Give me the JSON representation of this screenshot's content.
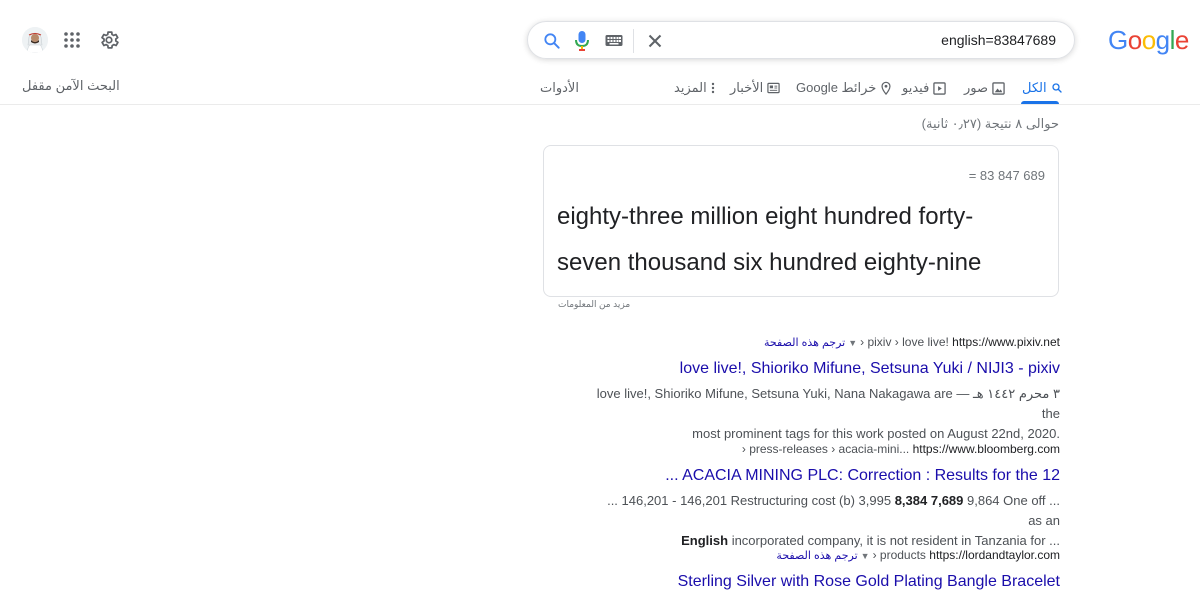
{
  "header": {
    "logo_letters": [
      {
        "char": "G",
        "color": "#4285f4"
      },
      {
        "char": "o",
        "color": "#ea4335"
      },
      {
        "char": "o",
        "color": "#fbbc05"
      },
      {
        "char": "g",
        "color": "#4285f4"
      },
      {
        "char": "l",
        "color": "#34a853"
      },
      {
        "char": "e",
        "color": "#ea4335"
      }
    ],
    "search_query": "english=83847689",
    "icons": [
      "search-icon",
      "mic-icon",
      "keyboard-icon",
      "clear-icon",
      "settings-icon",
      "apps-icon"
    ]
  },
  "nav": {
    "tabs": [
      {
        "label": "الكل",
        "icon": "search-icon",
        "active": true
      },
      {
        "label": "صور",
        "icon": "image-icon",
        "active": false
      },
      {
        "label": "فيديو",
        "icon": "video-icon",
        "active": false
      },
      {
        "label": "خرائط Google",
        "icon": "map-pin-icon",
        "active": false
      },
      {
        "label": "الأخبار",
        "icon": "news-icon",
        "active": false
      },
      {
        "label": "المزيد",
        "icon": "more-vert-icon",
        "active": false
      }
    ],
    "tools": "الأدوات",
    "safesearch": "البحث الآمن مقفل"
  },
  "result_stats": "حوالى ٨ نتيجة (٠٫٢٧ ثانية)",
  "calculator": {
    "number": "= 83 847 689",
    "words": "eighty-three million eight hundred forty-seven thousand six hundred eighty-nine",
    "more_info": "مزيد من المعلومات"
  },
  "results": [
    {
      "url": "https://www.pixiv.net",
      "crumbs": "› pixiv › love live!",
      "translate": "ترجم هذه الصفحة",
      "title": "love live!, Shioriko Mifune, Setsuna Yuki / NIJI3 - pixiv",
      "snippet_line1": "٣ محرم ١٤٤٢ هـ — love live!, Shioriko Mifune, Setsuna Yuki, Nana Nakagawa are the",
      "snippet_line2": "most prominent tags for this work posted on August 22nd, 2020."
    },
    {
      "url": "https://www.bloomberg.com",
      "crumbs": "› press-releases › acacia-mini...",
      "title": "... ACACIA MINING PLC: Correction : Results for the 12",
      "snippet_line1_a": "... 146,201 - 146,201 Restructuring cost (b) 3,995 ",
      "snippet_line1_bold": "8,384 7,689",
      "snippet_line1_b": " 9,864 One off ... as an",
      "snippet_line2_bold": "English",
      "snippet_line2_b": " incorporated company, it is not resident in Tanzania for ..."
    },
    {
      "url": "https://lordandtaylor.com",
      "crumbs": "› products",
      "translate": "ترجم هذه الصفحة",
      "title": "Sterling Silver with Rose Gold Plating Bangle Bracelet"
    }
  ]
}
